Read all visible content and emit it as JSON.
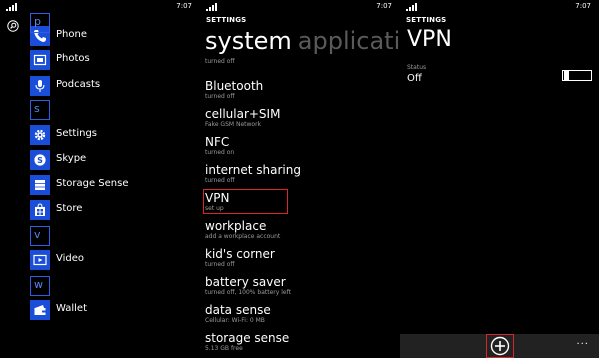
{
  "panel1": {
    "status_time": "7:07",
    "apps": [
      {
        "type": "app",
        "label": "Phone",
        "icon": "phone-icon"
      },
      {
        "type": "letter",
        "label": "p"
      },
      {
        "type": "app",
        "label": "Photos",
        "icon": "photos-icon"
      },
      {
        "type": "app",
        "label": "Podcasts",
        "icon": "podcasts-icon"
      },
      {
        "type": "letter",
        "label": "s"
      },
      {
        "type": "app",
        "label": "Settings",
        "icon": "gear-icon"
      },
      {
        "type": "app",
        "label": "Skype",
        "icon": "skype-icon"
      },
      {
        "type": "app",
        "label": "Storage Sense",
        "icon": "storage-icon"
      },
      {
        "type": "app",
        "label": "Store",
        "icon": "store-icon"
      },
      {
        "type": "letter",
        "label": "v"
      },
      {
        "type": "app",
        "label": "Video",
        "icon": "video-icon"
      },
      {
        "type": "letter",
        "label": "w"
      },
      {
        "type": "app",
        "label": "Wallet",
        "icon": "wallet-icon"
      }
    ]
  },
  "panel2": {
    "status_time": "7:07",
    "header": "SETTINGS",
    "pivot_active": "system",
    "pivot_inactive": "applications",
    "items": [
      {
        "name": "",
        "sub": "turned off"
      },
      {
        "name": "Bluetooth",
        "sub": "turned off"
      },
      {
        "name": "cellular+SIM",
        "sub": "Fake GSM Network"
      },
      {
        "name": "NFC",
        "sub": "turned on"
      },
      {
        "name": "internet sharing",
        "sub": "turned off"
      },
      {
        "name": "VPN",
        "sub": "set up"
      },
      {
        "name": "workplace",
        "sub": "add a workplace account"
      },
      {
        "name": "kid's corner",
        "sub": "turned off"
      },
      {
        "name": "battery saver",
        "sub": "turned off, 100% battery left"
      },
      {
        "name": "data sense",
        "sub": "Cellular:  Wi-Fi: 0 MB"
      },
      {
        "name": "storage sense",
        "sub": "5.13 GB free"
      }
    ]
  },
  "panel3": {
    "status_time": "7:07",
    "header": "SETTINGS",
    "title": "VPN",
    "status_label": "Status",
    "status_value": "Off",
    "toggle_on": false,
    "more": "...",
    "add_icon": "add-icon"
  },
  "colors": {
    "accent": "#1a4ed8",
    "highlight": "#d9262b",
    "subtext": "#9a9a9a",
    "appbar": "#222222"
  }
}
